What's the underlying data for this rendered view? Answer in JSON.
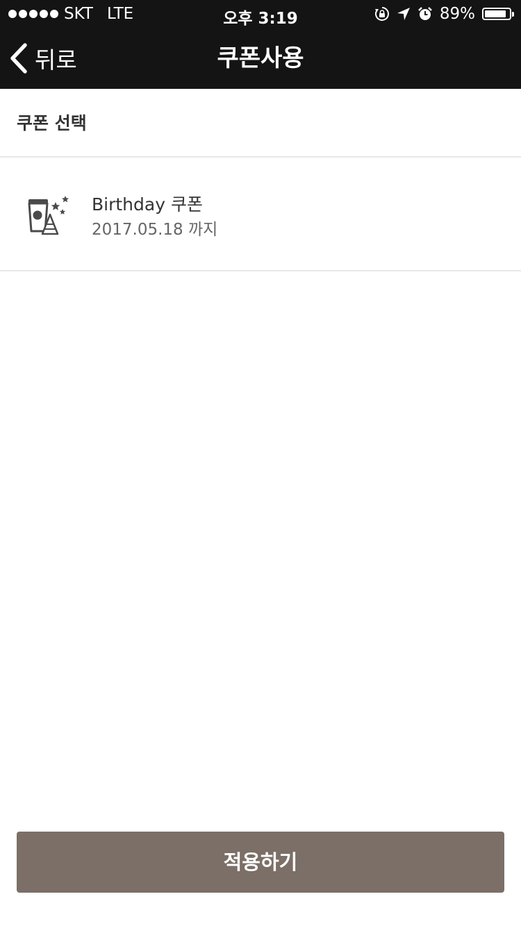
{
  "status_bar": {
    "carrier": "SKT",
    "network": "LTE",
    "time": "오후 3:19",
    "battery_percent": "89%",
    "battery_level": 0.89,
    "icons": [
      "orientation-lock-icon",
      "location-arrow-icon",
      "alarm-clock-icon",
      "battery-icon"
    ]
  },
  "nav": {
    "back_label": "뒤로",
    "title": "쿠폰사용"
  },
  "section": {
    "title": "쿠폰 선택"
  },
  "coupons": [
    {
      "name": "Birthday 쿠폰",
      "expiry": "2017.05.18 까지",
      "icon": "birthday-cup-icon"
    }
  ],
  "footer": {
    "apply_label": "적용하기"
  },
  "colors": {
    "header_bg": "#141414",
    "button_bg": "#7b6f67",
    "divider": "#e8e8e8",
    "text_primary": "#333333",
    "text_secondary": "#666666"
  }
}
